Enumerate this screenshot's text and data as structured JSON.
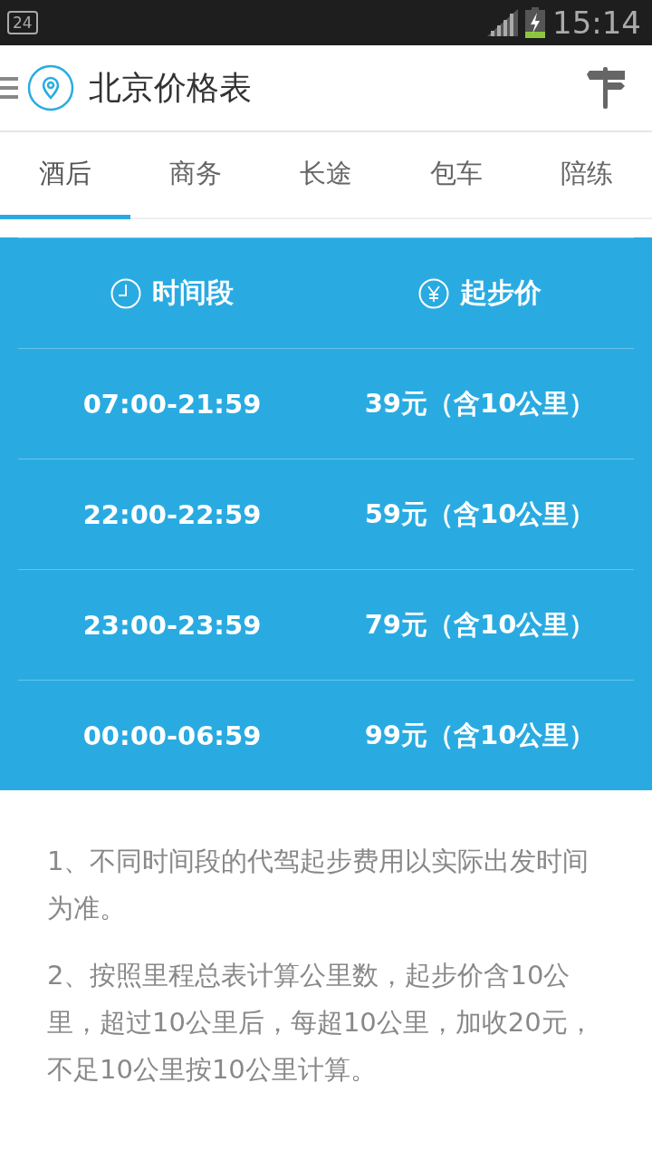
{
  "status_bar": {
    "notification": "24",
    "time": "15:14"
  },
  "header": {
    "title": "北京价格表"
  },
  "tabs": [
    {
      "label": "酒后",
      "selected": true
    },
    {
      "label": "商务",
      "selected": false
    },
    {
      "label": "长途",
      "selected": false
    },
    {
      "label": "包车",
      "selected": false
    },
    {
      "label": "陪练",
      "selected": false
    }
  ],
  "table": {
    "columns": [
      {
        "label": "时间段",
        "kind": "clock"
      },
      {
        "label": "起步价",
        "kind": "yen"
      }
    ],
    "rows": [
      {
        "time": "07:00-21:59",
        "price": "39元（含10公里）"
      },
      {
        "time": "22:00-22:59",
        "price": "59元（含10公里）"
      },
      {
        "time": "23:00-23:59",
        "price": "79元（含10公里）"
      },
      {
        "time": "00:00-06:59",
        "price": "99元（含10公里）"
      }
    ]
  },
  "notes": [
    "1、不同时间段的代驾起步费用以实际出发时间为准。",
    "2、按照里程总表计算公里数，起步价含10公里，超过10公里后，每超10公里，加收20元，不足10公里按10公里计算。"
  ]
}
